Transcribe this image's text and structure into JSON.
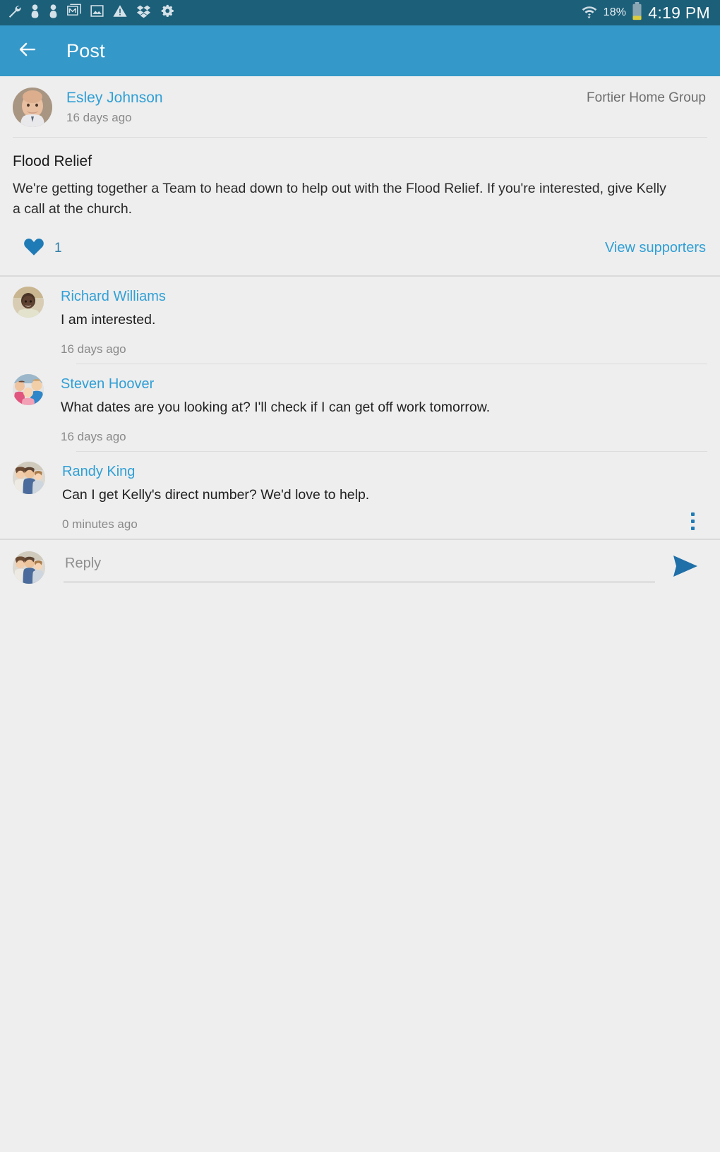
{
  "status_bar": {
    "icons": [
      "wrench-icon",
      "contact-icon",
      "contact-icon",
      "gmail-icon",
      "photo-icon",
      "warning-icon",
      "dropbox-icon",
      "settings-sync-icon"
    ],
    "wifi_icon": "wifi-icon",
    "battery_percent": "18%",
    "battery_icon": "battery-icon",
    "time": "4:19 PM"
  },
  "app_bar": {
    "back_icon": "back-arrow-icon",
    "title": "Post"
  },
  "post": {
    "author": "Esley Johnson",
    "timestamp": "16 days ago",
    "group": "Fortier Home Group",
    "title": "Flood Relief",
    "body": "We're getting together a Team to head down to help out with the Flood Relief. If you're interested, give Kelly a call at the church.",
    "like_icon": "heart-icon",
    "like_count": "1",
    "view_supporters_label": "View supporters",
    "accent_color": "#2f9fd6",
    "heart_color": "#1f7bb6"
  },
  "comments": [
    {
      "author": "Richard Williams",
      "text": "I am interested.",
      "timestamp": "16 days ago",
      "has_menu": false
    },
    {
      "author": "Steven Hoover",
      "text": "What dates are you looking at? I'll check if I can get off work tomorrow.",
      "timestamp": "16 days ago",
      "has_menu": false
    },
    {
      "author": "Randy King",
      "text": "Can I get Kelly's direct number? We'd love to help.",
      "timestamp": "0 minutes ago",
      "has_menu": true,
      "menu_icon": "overflow-menu-icon"
    }
  ],
  "reply_bar": {
    "avatar": "user-avatar",
    "placeholder": "Reply",
    "value": "",
    "send_icon": "send-icon",
    "send_color": "#1f7bb6"
  }
}
